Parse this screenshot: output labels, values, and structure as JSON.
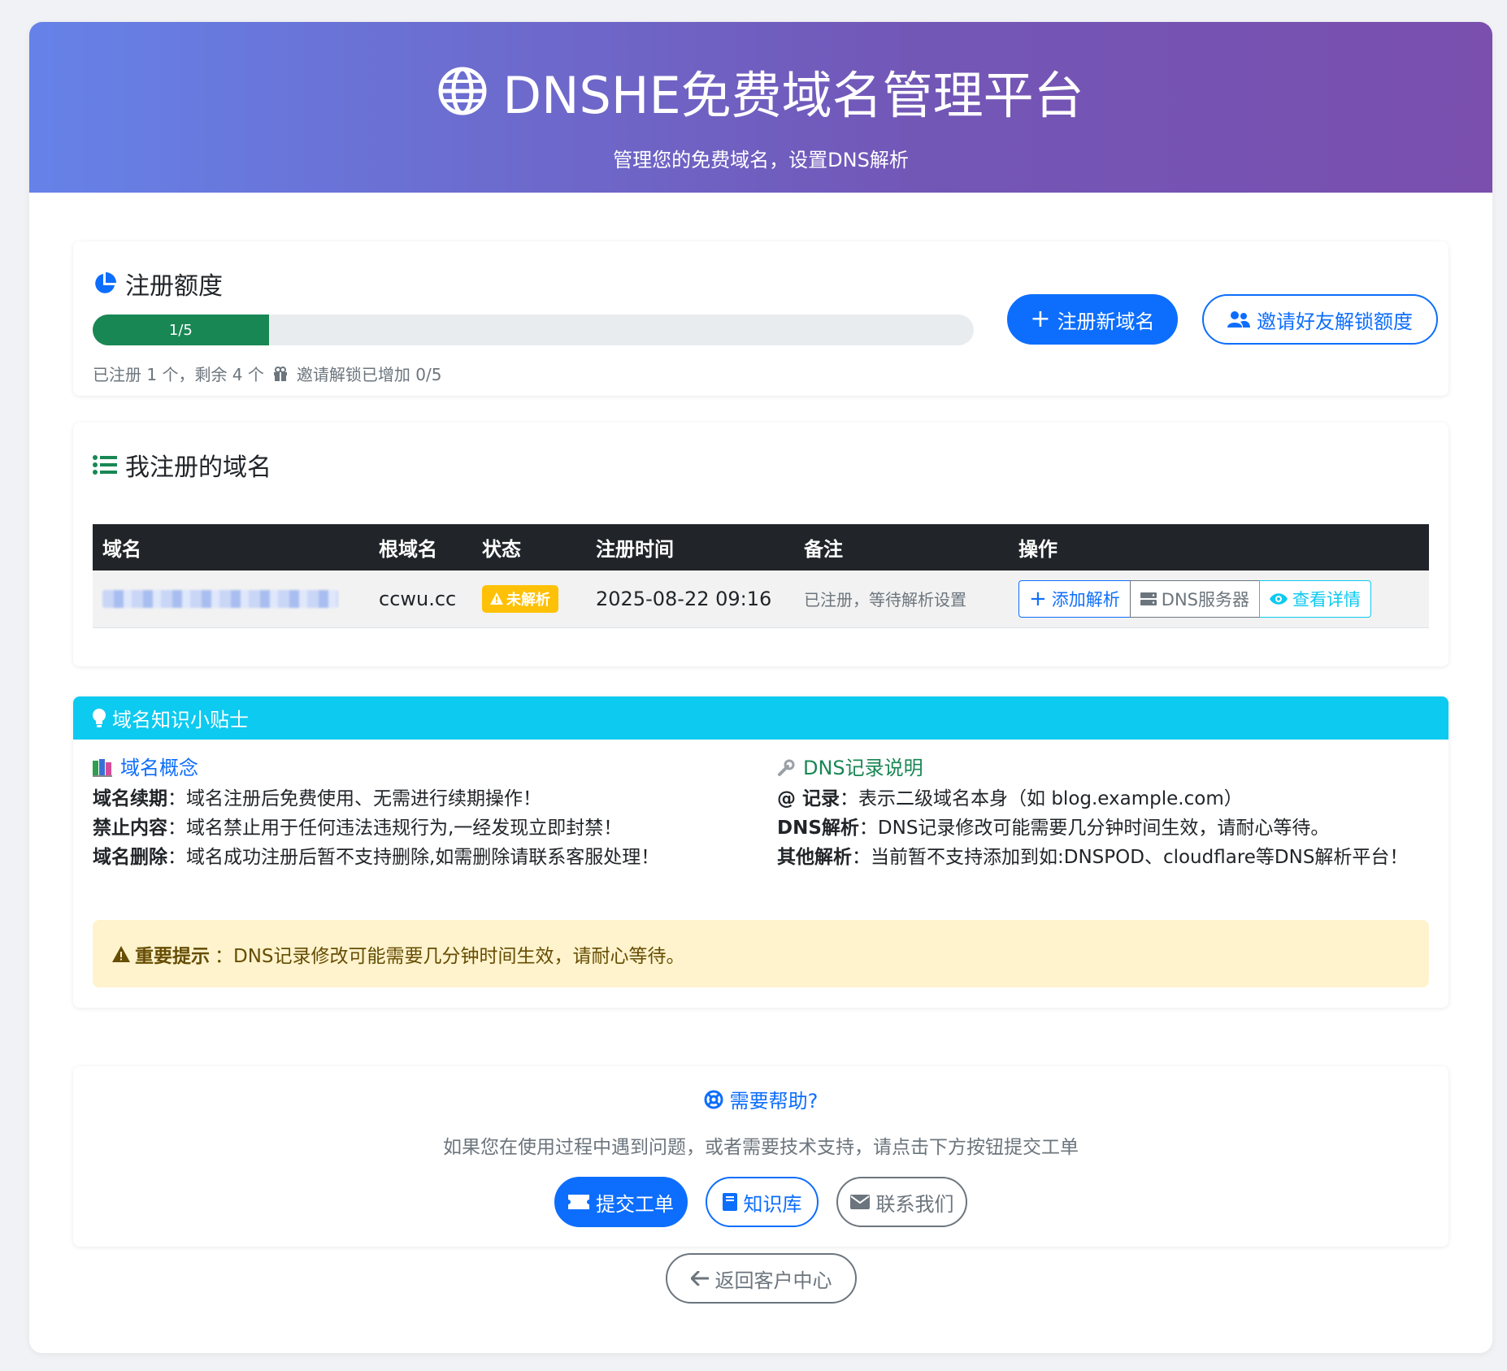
{
  "header": {
    "title": "DNSHE免费域名管理平台",
    "subtitle": "管理您的免费域名，设置DNS解析"
  },
  "quota": {
    "title": "注册额度",
    "progress_label": "1/5",
    "progress_fraction": 0.2,
    "used_text": "已注册 1 个，剩余 4 个",
    "invite_text": "邀请解锁已增加 0/5",
    "register_button": "注册新域名",
    "invite_button": "邀请好友解锁额度"
  },
  "domains": {
    "title": "我注册的域名",
    "columns": [
      "域名",
      "根域名",
      "状态",
      "注册时间",
      "备注",
      "操作"
    ],
    "rows": [
      {
        "root_domain": "ccwu.cc",
        "status": "未解析",
        "registered_at": "2025-08-22 09:16",
        "note": "已注册，等待解析设置",
        "actions": [
          "添加解析",
          "DNS服务器",
          "查看详情"
        ]
      }
    ]
  },
  "tips": {
    "title": "域名知识小贴士",
    "concept": {
      "title": "域名概念",
      "items": [
        {
          "label": "域名续期",
          "text": "：域名注册后免费使用、无需进行续期操作！"
        },
        {
          "label": "禁止内容",
          "text": "：域名禁止用于任何违法违规行为,一经发现立即封禁！"
        },
        {
          "label": "域名删除",
          "text": "：域名成功注册后暂不支持删除,如需删除请联系客服处理！"
        }
      ]
    },
    "dns": {
      "title": "DNS记录说明",
      "items": [
        {
          "label": "@ 记录",
          "text": "：表示二级域名本身（如 blog.example.com）"
        },
        {
          "label": "DNS解析",
          "text": "：DNS记录修改可能需要几分钟时间生效，请耐心等待。"
        },
        {
          "label": "其他解析",
          "text": "：当前暂不支持添加到如:DNSPOD、cloudflare等DNS解析平台！"
        }
      ]
    },
    "alert_label": "重要提示",
    "alert_text": "：DNS记录修改可能需要几分钟时间生效，请耐心等待。"
  },
  "help": {
    "title": "需要帮助?",
    "text": "如果您在使用过程中遇到问题，或者需要技术支持，请点击下方按钮提交工单",
    "ticket_button": "提交工单",
    "kb_button": "知识库",
    "contact_button": "联系我们"
  },
  "back_button": "返回客户中心",
  "colors": {
    "primary": "#0d6efd",
    "success": "#198754",
    "info": "#0dcaf0",
    "warning": "#ffc107",
    "dark": "#212529"
  }
}
